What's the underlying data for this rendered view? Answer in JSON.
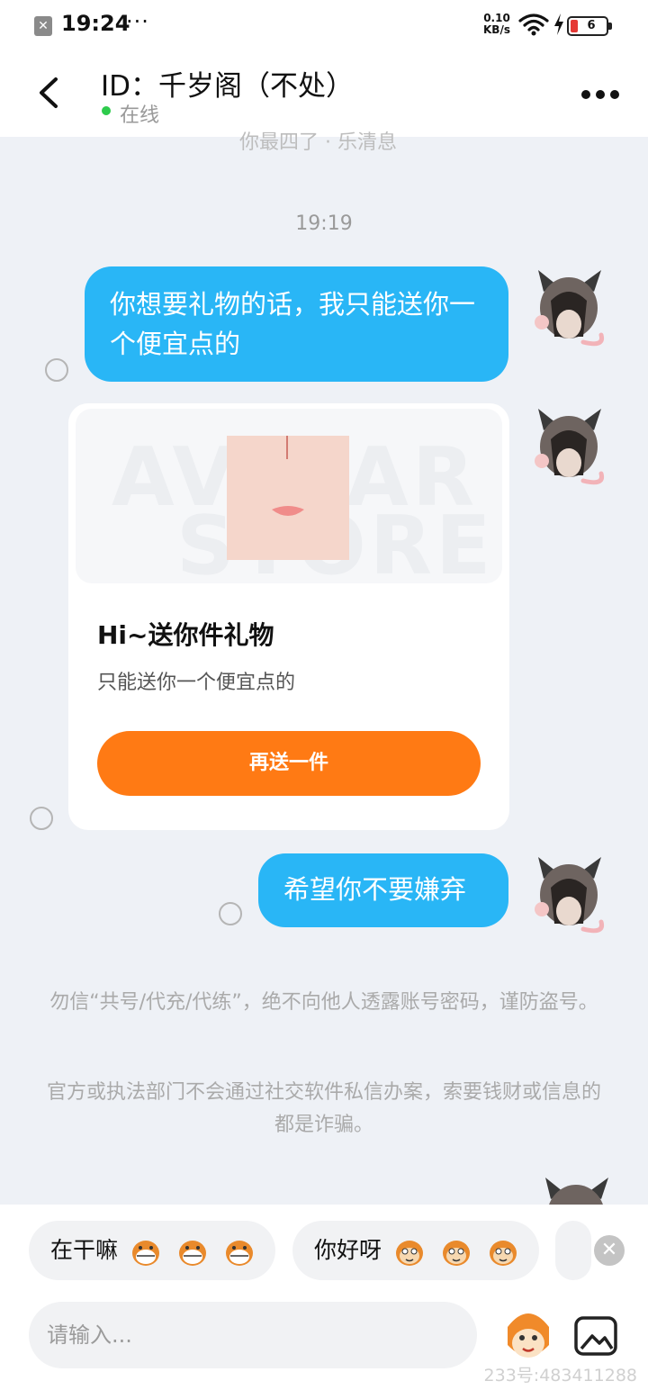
{
  "status_bar": {
    "time": "19:24",
    "dots": "···",
    "speed_top": "0.10",
    "speed_bottom": "KB/s",
    "battery": "6"
  },
  "header": {
    "title": "ID：千岁阁（不处）",
    "status": "在线"
  },
  "chat": {
    "cutoff_text": "你最四了  ·  乐清息",
    "timestamp": "19:19",
    "messages": [
      {
        "text": "你想要礼物的话，我只能送你一个便宜点的"
      },
      {
        "text": "希望你不要嫌弃"
      }
    ],
    "gift_card": {
      "watermark_line1": "AVATAR",
      "watermark_line2": "STORE",
      "title": "Hi~送你件礼物",
      "description": "只能送你一个便宜点的",
      "button": "再送一件"
    }
  },
  "notices": {
    "anti_fraud_1": "勿信“共号/代充/代练”，绝不向他人透露账号密码，谨防盗号。",
    "anti_fraud_2": "官方或执法部门不会通过社交软件私信办案，索要钱财或信息的都是诈骗。"
  },
  "quick_replies": [
    {
      "text": "在干嘛",
      "emoji": "grinning-monkey"
    },
    {
      "text": "你好呀",
      "emoji": "smiling-monkey"
    }
  ],
  "input": {
    "placeholder": "请输入..."
  },
  "watermark": "233号:483411288",
  "colors": {
    "bubble": "#29b6f6",
    "gift_button": "#ff7a14",
    "online": "#2ecb4c",
    "background": "#eef1f6"
  }
}
